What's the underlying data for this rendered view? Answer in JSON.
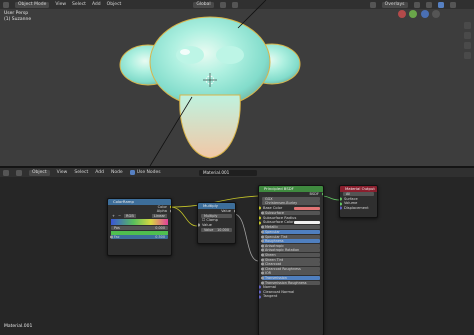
{
  "viewport": {
    "header": {
      "mode": "Object Mode",
      "menus": [
        "View",
        "Select",
        "Add",
        "Object"
      ],
      "orientation": "Global",
      "overlays": "Overlays"
    },
    "info": {
      "line1": "User Persp",
      "line2": "(1) Suzanne"
    }
  },
  "node_editor": {
    "header": {
      "type": "Object",
      "menus": [
        "View",
        "Select",
        "Add",
        "Node"
      ],
      "use_nodes": "Use Nodes",
      "material": "Material.001"
    },
    "footer": "Material.001",
    "nodes": {
      "colorramp": {
        "title": "ColorRamp",
        "out_color": "Color",
        "out_alpha": "Alpha",
        "mode1": "RGB",
        "interp": "Linear",
        "pos_label": "Pos",
        "pos_value": "0.000",
        "fac_label": "Fac",
        "fac_value": "0.500"
      },
      "multiply": {
        "title": "Multiply",
        "out_value": "Value",
        "op": "Multiply",
        "clamp": "Clamp",
        "in_value": "Value",
        "in2_label": "Value",
        "in2_value": "10.000"
      },
      "bsdf": {
        "title": "Principled BSDF",
        "out": "BSDF",
        "dist": "GGX",
        "sss_method": "Christensen-Burley",
        "rows": [
          "Base Color",
          "Subsurface",
          "Subsurface Radius",
          "Subsurface Color",
          "Metallic",
          "Specular",
          "Specular Tint",
          "Roughness",
          "Anisotropic",
          "Anisotropic Rotation",
          "Sheen",
          "Sheen Tint",
          "Clearcoat",
          "Clearcoat Roughness",
          "IOR",
          "Transmission",
          "Transmission Roughness",
          "Normal",
          "Clearcoat Normal",
          "Tangent"
        ]
      },
      "output": {
        "title": "Material Output",
        "target": "All",
        "surface": "Surface",
        "volume": "Volume",
        "displacement": "Displacement"
      }
    }
  },
  "colors": {
    "bsdf_header": "#3f8a3f",
    "output_header": "#8a1f2e",
    "colorramp_header": "#3d6e9a",
    "multiply_header": "#3d6e9a"
  }
}
